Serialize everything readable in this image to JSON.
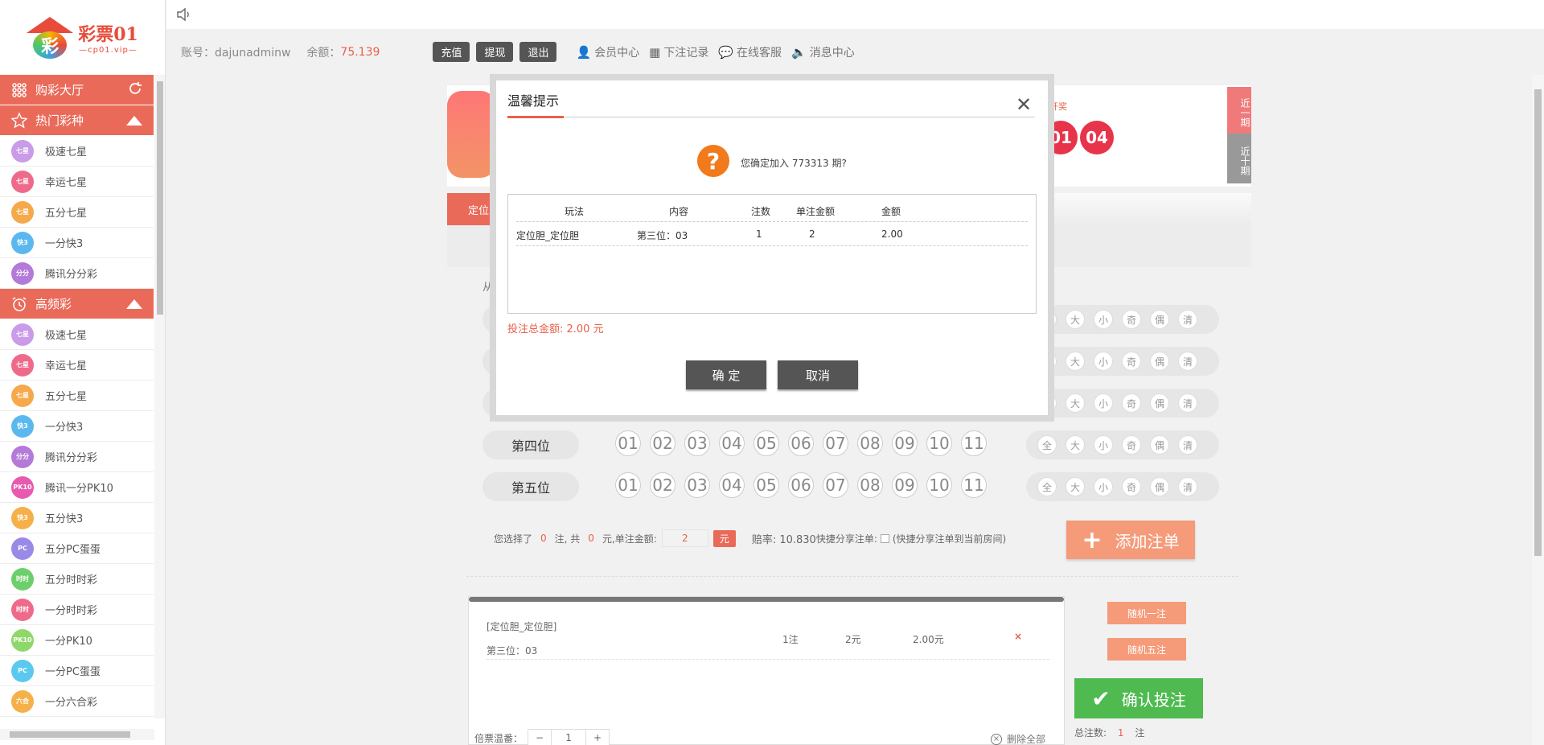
{
  "brand": {
    "logo_char": "彩",
    "name": "彩票01",
    "domain": "—cp01.vip—"
  },
  "sidebar": {
    "hall_label": "购彩大厅",
    "hot_label": "热门彩种",
    "hot_items": [
      {
        "label": "极速七星",
        "color": "#c99be8",
        "tag": "七星"
      },
      {
        "label": "幸运七星",
        "color": "#ef6a8a",
        "tag": "七星"
      },
      {
        "label": "五分七星",
        "color": "#f5a94a",
        "tag": "七星"
      },
      {
        "label": "一分快3",
        "color": "#5bb8ef",
        "tag": "快3"
      },
      {
        "label": "腾讯分分彩",
        "color": "#b47ad8",
        "tag": "分分"
      }
    ],
    "freq_label": "高频彩",
    "freq_items": [
      {
        "label": "极速七星",
        "color": "#c99be8",
        "tag": "七星"
      },
      {
        "label": "幸运七星",
        "color": "#ef6a8a",
        "tag": "七星"
      },
      {
        "label": "五分七星",
        "color": "#f5a94a",
        "tag": "七星"
      },
      {
        "label": "一分快3",
        "color": "#5bb8ef",
        "tag": "快3"
      },
      {
        "label": "腾讯分分彩",
        "color": "#b47ad8",
        "tag": "分分"
      },
      {
        "label": "腾讯一分PK10",
        "color": "#e85ab0",
        "tag": "PK10"
      },
      {
        "label": "五分快3",
        "color": "#f5b04a",
        "tag": "快3"
      },
      {
        "label": "五分PC蛋蛋",
        "color": "#9a8ae8",
        "tag": "PC"
      },
      {
        "label": "五分时时彩",
        "color": "#6ccf6c",
        "tag": "时时"
      },
      {
        "label": "一分时时彩",
        "color": "#ef6a8a",
        "tag": "时时"
      },
      {
        "label": "一分PK10",
        "color": "#8ed86a",
        "tag": "PK10"
      },
      {
        "label": "一分PC蛋蛋",
        "color": "#5bc8ef",
        "tag": "PC"
      },
      {
        "label": "一分六合彩",
        "color": "#f5b04a",
        "tag": "六合"
      }
    ]
  },
  "account": {
    "account_label": "账号：dajunadminw",
    "balance_label": "余额：",
    "balance_value": "75.139",
    "recharge": "充值",
    "withdraw": "提现",
    "logout": "退出",
    "nav": [
      "会员中心",
      "下注记录",
      "在线客服",
      "消息中心"
    ]
  },
  "game": {
    "kj_label": "开奖",
    "balls": [
      "01",
      "04"
    ],
    "recent1": "近一期",
    "recent10": "近十期",
    "tab0": "定位",
    "from_label": "从"
  },
  "rows": [
    {
      "label": "第四位"
    },
    {
      "label": "第五位"
    }
  ],
  "numbers": [
    "01",
    "02",
    "03",
    "04",
    "05",
    "06",
    "07",
    "08",
    "09",
    "10",
    "11"
  ],
  "quick": [
    "全",
    "大",
    "小",
    "奇",
    "偶",
    "清"
  ],
  "selection": {
    "prefix": "您选择了",
    "count": "0",
    "mid": "注, 共",
    "total": "0",
    "unit_label": "元,单注金额:",
    "amount": "2",
    "yuan": "元",
    "odds": "赔率: 10.830",
    "share_label": "快捷分享注单:",
    "share_hint": "(快捷分享注单到当前房间)",
    "add_button": "添加注单"
  },
  "cart": {
    "play": "[定位胆_定位胆]",
    "detail": "第三位：03",
    "bets": "1注",
    "unit": "2元",
    "amount": "2.00元",
    "delete": "×",
    "multiplier_label": "倍票温番：",
    "multiplier": "1",
    "delete_all": "删除全部"
  },
  "side_actions": {
    "random1": "随机一注",
    "random5": "随机五注",
    "confirm": "确认投注",
    "total_label": "总注数:",
    "total_value": "1",
    "total_unit": "注"
  },
  "modal": {
    "title": "温馨提示",
    "question": "您确定加入 773313 期?",
    "headers": [
      "玩法",
      "内容",
      "注数",
      "单注金额",
      "金额"
    ],
    "row": [
      "定位胆_定位胆",
      "第三位：03",
      "1",
      "2",
      "2.00"
    ],
    "total": "投注总金额: 2.00 元",
    "ok": "确 定",
    "cancel": "取消"
  }
}
